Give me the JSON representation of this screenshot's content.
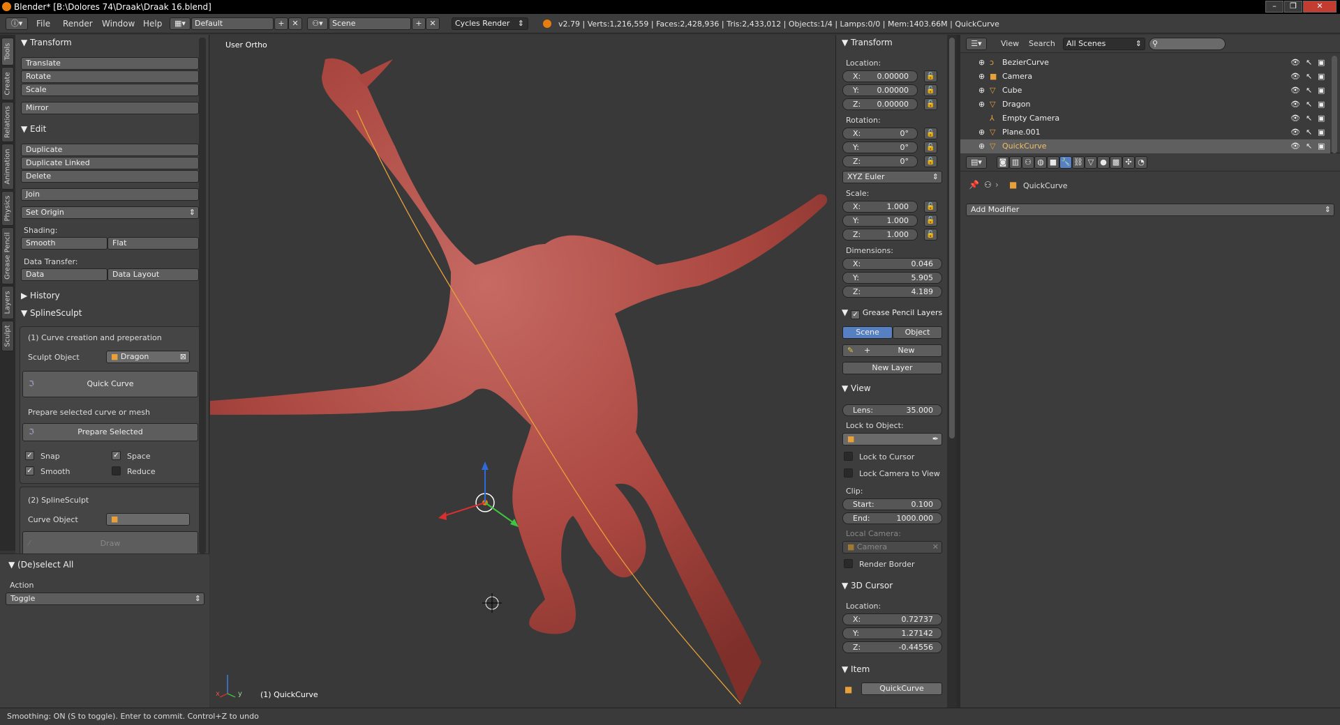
{
  "window": {
    "title": "Blender* [B:\\Dolores 74\\Draak\\Draak 16.blend]"
  },
  "topbar": {
    "menus": [
      "File",
      "Render",
      "Window",
      "Help"
    ],
    "screen_layout": "Default",
    "scene": "Scene",
    "render_engine": "Cycles Render",
    "info": "v2.79 | Verts:1,216,559 | Faces:2,428,936 | Tris:2,433,012 | Objects:1/4 | Lamps:0/0 | Mem:1403.66M | QuickCurve"
  },
  "shelf_tabs": [
    "Tools",
    "Create",
    "Relations",
    "Animation",
    "Physics",
    "Grease Pencil",
    "Layers",
    "Sculpt"
  ],
  "tools": {
    "transform_header": "Transform",
    "translate": "Translate",
    "rotate": "Rotate",
    "scale": "Scale",
    "mirror": "Mirror",
    "edit_header": "Edit",
    "duplicate": "Duplicate",
    "duplicate_linked": "Duplicate Linked",
    "delete": "Delete",
    "join": "Join",
    "set_origin": "Set Origin",
    "shading_label": "Shading:",
    "smooth": "Smooth",
    "flat": "Flat",
    "data_transfer_label": "Data Transfer:",
    "data": "Data",
    "data_layout": "Data Layout",
    "history_header": "History",
    "splinesculpt_header": "SplineSculpt",
    "section1": "(1) Curve creation and preperation",
    "sculpt_object_label": "Sculpt Object",
    "sculpt_object_value": "Dragon",
    "quick_curve": "Quick Curve",
    "prepare_hint": "Prepare selected curve or mesh",
    "prepare_selected": "Prepare Selected",
    "snap": "Snap",
    "space": "Space",
    "smooth_opt": "Smooth",
    "reduce": "Reduce",
    "section2": "(2) SplineSculpt",
    "curve_object_label": "Curve Object",
    "draw": "Draw"
  },
  "operator": {
    "header": "(De)select All",
    "action_label": "Action",
    "action_value": "Toggle"
  },
  "viewport": {
    "view_name": "User Ortho",
    "active_object": "(1) QuickCurve",
    "axis_x": "x",
    "axis_y": "y"
  },
  "npanel": {
    "transform_header": "Transform",
    "location_label": "Location:",
    "loc_x": "0.00000",
    "loc_y": "0.00000",
    "loc_z": "0.00000",
    "rotation_label": "Rotation:",
    "rot_x": "0°",
    "rot_y": "0°",
    "rot_z": "0°",
    "rotation_mode": "XYZ Euler",
    "scale_label": "Scale:",
    "scale_x": "1.000",
    "scale_y": "1.000",
    "scale_z": "1.000",
    "dimensions_label": "Dimensions:",
    "dim_x": "0.046",
    "dim_y": "5.905",
    "dim_z": "4.189",
    "grease_header": "Grease Pencil Layers",
    "scene_tab": "Scene",
    "object_tab": "Object",
    "new": "New",
    "new_layer": "New Layer",
    "view_header": "View",
    "lens_label": "Lens:",
    "lens_value": "35.000",
    "lock_to_object": "Lock to Object:",
    "lock_to_cursor": "Lock to Cursor",
    "lock_camera": "Lock Camera to View",
    "clip_label": "Clip:",
    "clip_start_label": "Start:",
    "clip_start": "0.100",
    "clip_end_label": "End:",
    "clip_end": "1000.000",
    "local_camera_label": "Local Camera:",
    "local_camera_value": "Camera",
    "render_border": "Render Border",
    "cursor_header": "3D Cursor",
    "cursor_location_label": "Location:",
    "cur_x": "0.72737",
    "cur_y": "1.27142",
    "cur_z": "-0.44556",
    "item_header": "Item",
    "item_name": "QuickCurve",
    "x_label": "X:",
    "y_label": "Y:",
    "z_label": "Z:"
  },
  "outliner": {
    "view_menu": "View",
    "search_menu": "Search",
    "filter": "All Scenes",
    "items": [
      "BezierCurve",
      "Camera",
      "Cube",
      "Dragon",
      "Empty Camera",
      "Plane.001",
      "QuickCurve"
    ]
  },
  "properties": {
    "breadcrumb": "QuickCurve",
    "add_modifier": "Add Modifier"
  },
  "statusbar": {
    "text": "Smoothing: ON (S to toggle). Enter to commit. Control+Z to undo"
  }
}
